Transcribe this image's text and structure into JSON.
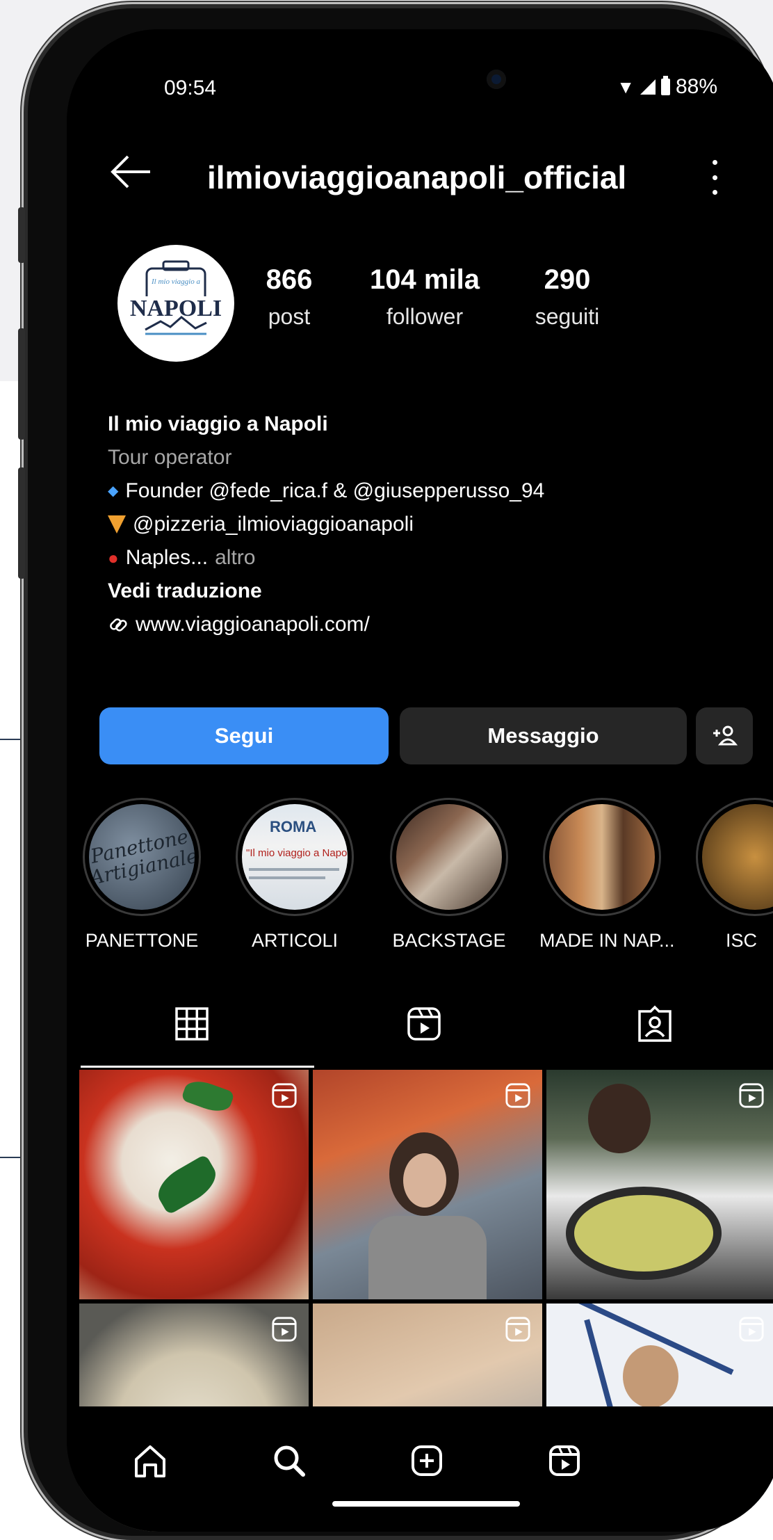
{
  "status_bar": {
    "time": "09:54",
    "battery": "88%"
  },
  "header": {
    "username": "ilmioviaggioanapoli_official"
  },
  "avatar": {
    "logo_text": "NAPOLI",
    "logo_small": "Il mio viaggio a"
  },
  "stats": [
    {
      "value": "866",
      "label": "post"
    },
    {
      "value": "104 mila",
      "label": "follower"
    },
    {
      "value": "290",
      "label": "seguiti"
    }
  ],
  "bio": {
    "name": "Il mio viaggio a Napoli",
    "category": "Tour operator",
    "line1": "Founder @fede_rica.f & @giusepperusso_94",
    "line2": "@pizzeria_ilmioviaggioanapoli",
    "line3": "Naples...",
    "more": "altro",
    "translate": "Vedi traduzione",
    "link": "www.viaggioanapoli.com/"
  },
  "actions": {
    "follow": "Segui",
    "message": "Messaggio",
    "add_person": "+♀"
  },
  "highlights": [
    {
      "label": "PANETTONE",
      "pic_text": "Panettone Artigianale"
    },
    {
      "label": "ARTICOLI",
      "pic_text": "ROMA"
    },
    {
      "label": "BACKSTAGE"
    },
    {
      "label": "MADE IN NAP..."
    },
    {
      "label": "ISC"
    }
  ],
  "highlight_caption": "\"Il mio viaggio a Napoli\"",
  "tabs": [
    "grid-icon",
    "reels-icon",
    "tagged-icon"
  ],
  "colors": {
    "accent": "#3a8ef5",
    "background": "#000000",
    "secondary_button": "#262626",
    "muted_text": "#a8a8a8"
  }
}
